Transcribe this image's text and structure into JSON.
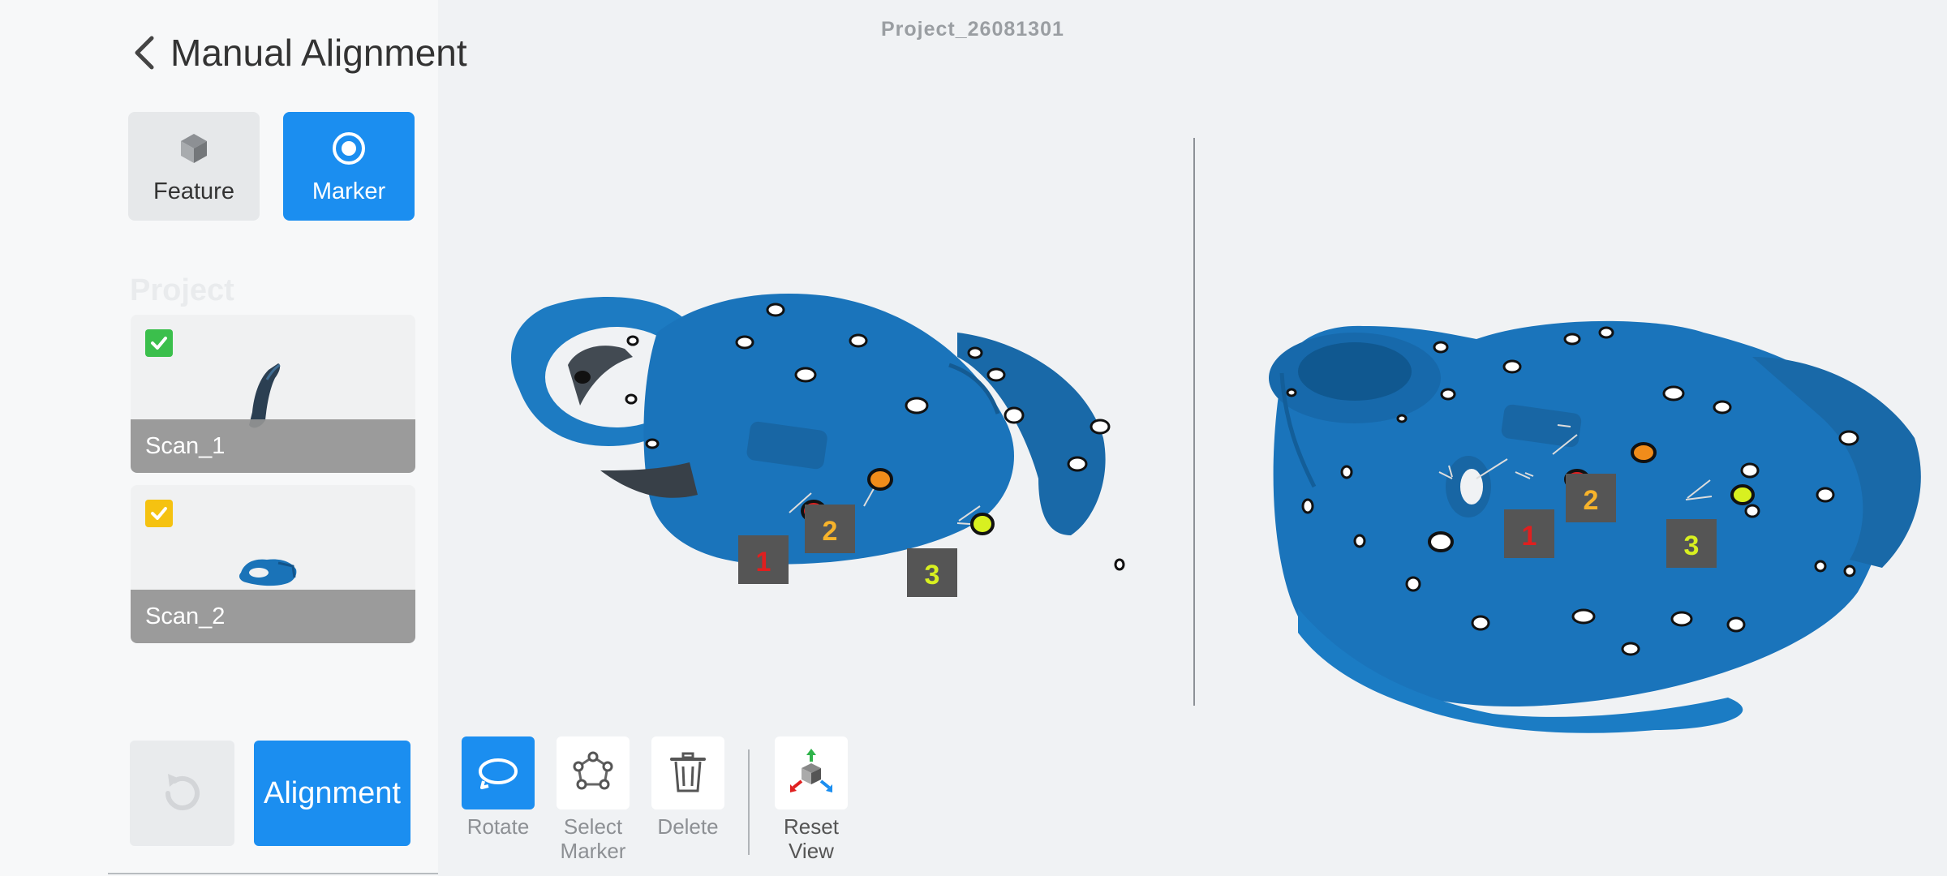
{
  "header": {
    "project_name": "Project_26081301"
  },
  "left_panel": {
    "title": "Manual Alignment",
    "modes": [
      {
        "label": "Feature",
        "icon": "cube-icon",
        "selected": false
      },
      {
        "label": "Marker",
        "icon": "target-icon",
        "selected": true
      }
    ],
    "project_label": "Project",
    "scans": [
      {
        "name": "Scan_1",
        "checked": true,
        "check_color": "#3bbf4c"
      },
      {
        "name": "Scan_2",
        "checked": true,
        "check_color": "#f5c211"
      }
    ],
    "undo_icon": "refresh-icon",
    "align_label": "Alignment"
  },
  "viewports": {
    "left": {
      "labels": [
        "1",
        "2",
        "3"
      ],
      "label_colors": [
        "#e01f1f",
        "#f7b32b",
        "#d8f020"
      ]
    },
    "right": {
      "labels": [
        "1",
        "2",
        "3"
      ],
      "label_colors": [
        "#e01f1f",
        "#f7b32b",
        "#d8f020"
      ]
    }
  },
  "toolbar": {
    "rotate_label": "Rotate",
    "select_label": "Select Marker",
    "delete_label": "Delete",
    "reset_label": "Reset View"
  },
  "colors": {
    "accent": "#1b8ef0",
    "mesh": "#1a73b8"
  }
}
